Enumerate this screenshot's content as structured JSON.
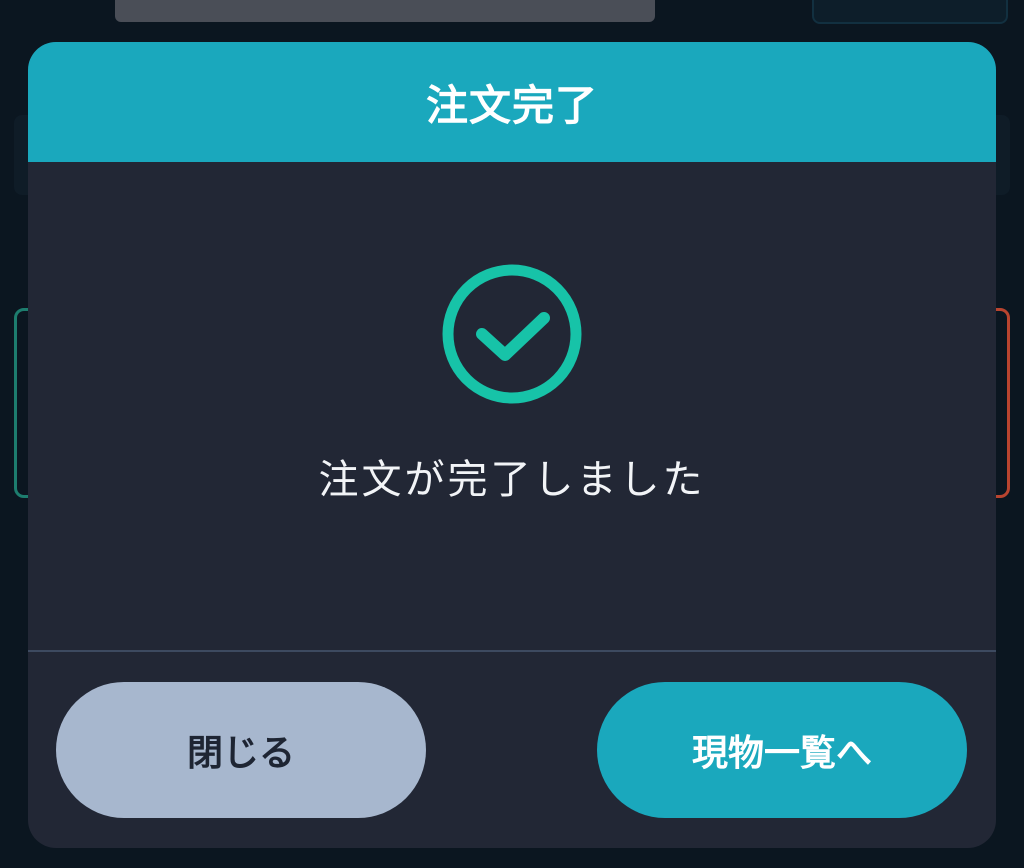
{
  "modal": {
    "title": "注文完了",
    "message": "注文が完了しました",
    "icon": "check-circle-icon",
    "accent_color": "#1aa8bd",
    "check_color": "#17c3a8"
  },
  "buttons": {
    "close_label": "閉じる",
    "list_label": "現物一覧へ"
  }
}
